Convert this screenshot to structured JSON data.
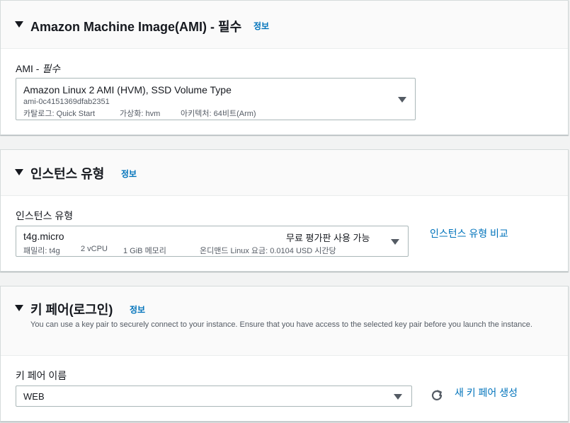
{
  "ami_section": {
    "title": "Amazon Machine Image(AMI) - 필수",
    "info": "정보",
    "field_label": "AMI - ",
    "field_label_required": "필수",
    "selected": {
      "name": "Amazon Linux 2 AMI (HVM), SSD Volume Type",
      "id": "ami-0c4151369dfab2351",
      "catalog": "카탈로그: Quick Start",
      "virtualization": "가상화: hvm",
      "architecture": "아키텍처: 64비트(Arm)"
    }
  },
  "instance_section": {
    "title": "인스턴스 유형",
    "info": "정보",
    "field_label": "인스턴스 유형",
    "selected": {
      "name": "t4g.micro",
      "free_tier": "무료 평가판 사용 가능",
      "family": "패밀리: t4g",
      "vcpu": "2 vCPU",
      "memory": "1 GiB 메모리",
      "pricing": "온디맨드 Linux 요금: 0.0104 USD 시간당"
    },
    "compare_link": "인스턴스 유형 비교"
  },
  "keypair_section": {
    "title": "키 페어(로그인)",
    "info": "정보",
    "description": "You can use a key pair to securely connect to your instance. Ensure that you have access to the selected key pair before you launch the instance.",
    "field_label": "키 페어 이름",
    "selected": "WEB",
    "new_link": "새 키 페어 생성",
    "refresh_icon": "refresh-icon"
  },
  "colors": {
    "link": "#0073bb",
    "header_bg": "#fafafa",
    "page_bg": "#f2f3f3"
  }
}
